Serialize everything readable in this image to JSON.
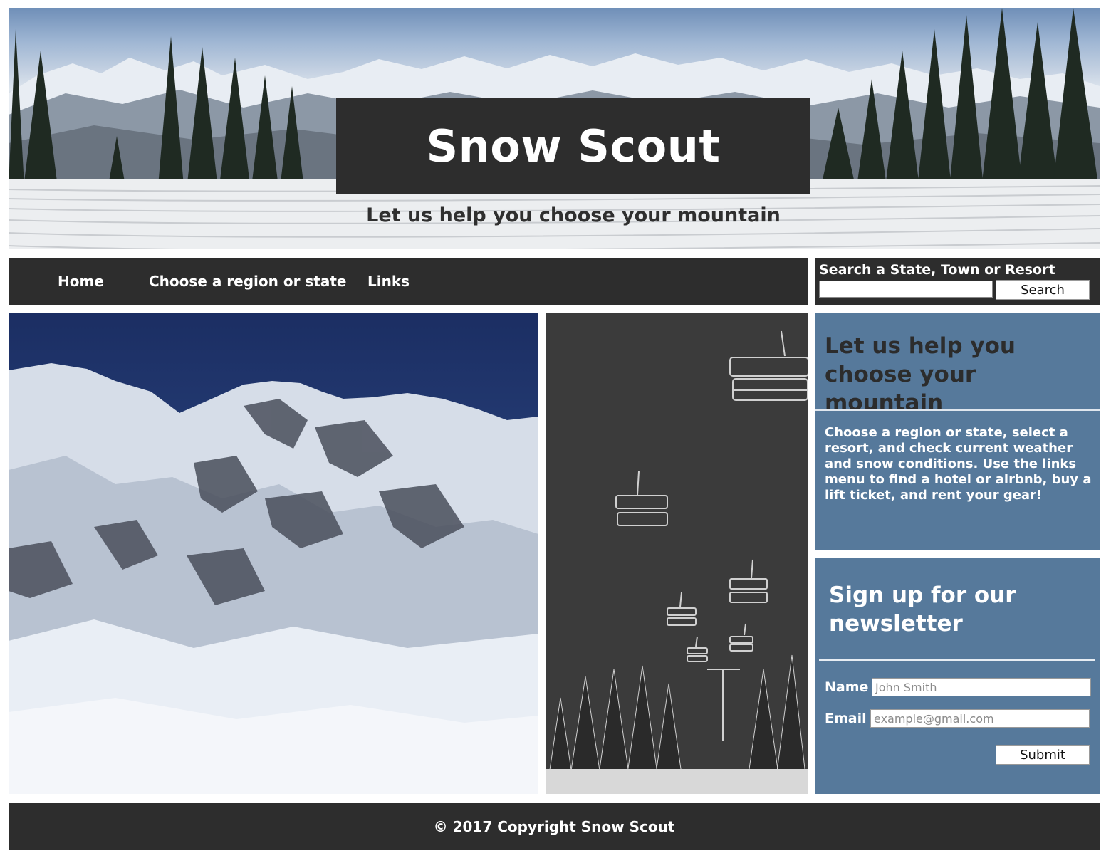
{
  "hero": {
    "title": "Snow Scout",
    "tagline": "Let us help you choose your mountain"
  },
  "nav": {
    "items": [
      {
        "label": "Home"
      },
      {
        "label": "Choose a region or state"
      },
      {
        "label": "Links"
      }
    ]
  },
  "search": {
    "label": "Search a State, Town or Resort",
    "value": "",
    "button_label": "Search"
  },
  "info": {
    "heading": "Let us help you choose your mountain",
    "text": "Choose a region or state, select a resort, and check current weather and snow conditions. Use the links menu to find a hotel or airbnb, buy a lift ticket, and rent your gear!"
  },
  "newsletter": {
    "heading": "Sign up for our newsletter",
    "name_label": "Name",
    "name_placeholder": "John Smith",
    "email_label": "Email",
    "email_placeholder": "example@gmail.com",
    "submit_label": "Submit"
  },
  "footer": {
    "text": "© 2017 Copyright Snow Scout"
  },
  "colors": {
    "dark_bar": "#2d2d2d",
    "panel_blue": "#56799b"
  }
}
